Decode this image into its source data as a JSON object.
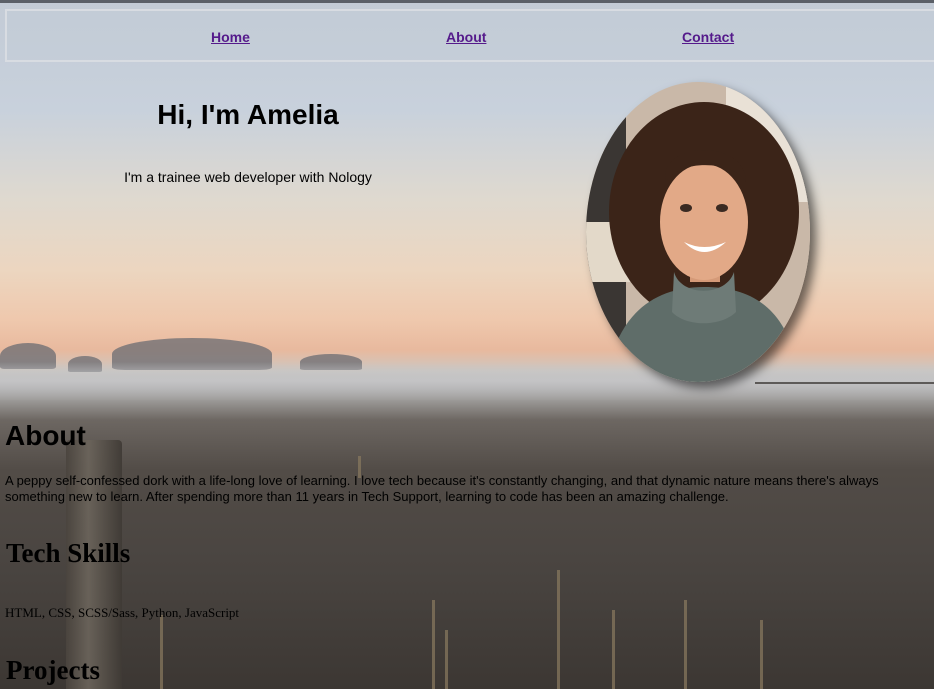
{
  "nav": {
    "home": "Home",
    "about": "About",
    "contact": "Contact"
  },
  "hero": {
    "title": "Hi, I'm Amelia",
    "subtitle": "I'm a trainee web developer with Nology"
  },
  "about": {
    "heading": "About",
    "text": "A peppy self-confessed dork with a life-long love of learning. I love tech because it's constantly changing, and that dynamic nature means there's always something new to learn. After spending more than 11 years in Tech Support, learning to code has been an amazing challenge."
  },
  "skills": {
    "heading": "Tech Skills",
    "text": "HTML, CSS, SCSS/Sass, Python, JavaScript"
  },
  "projects": {
    "heading": "Projects"
  },
  "colors": {
    "link": "#551a8b",
    "nav_border": "#d8dce2"
  }
}
